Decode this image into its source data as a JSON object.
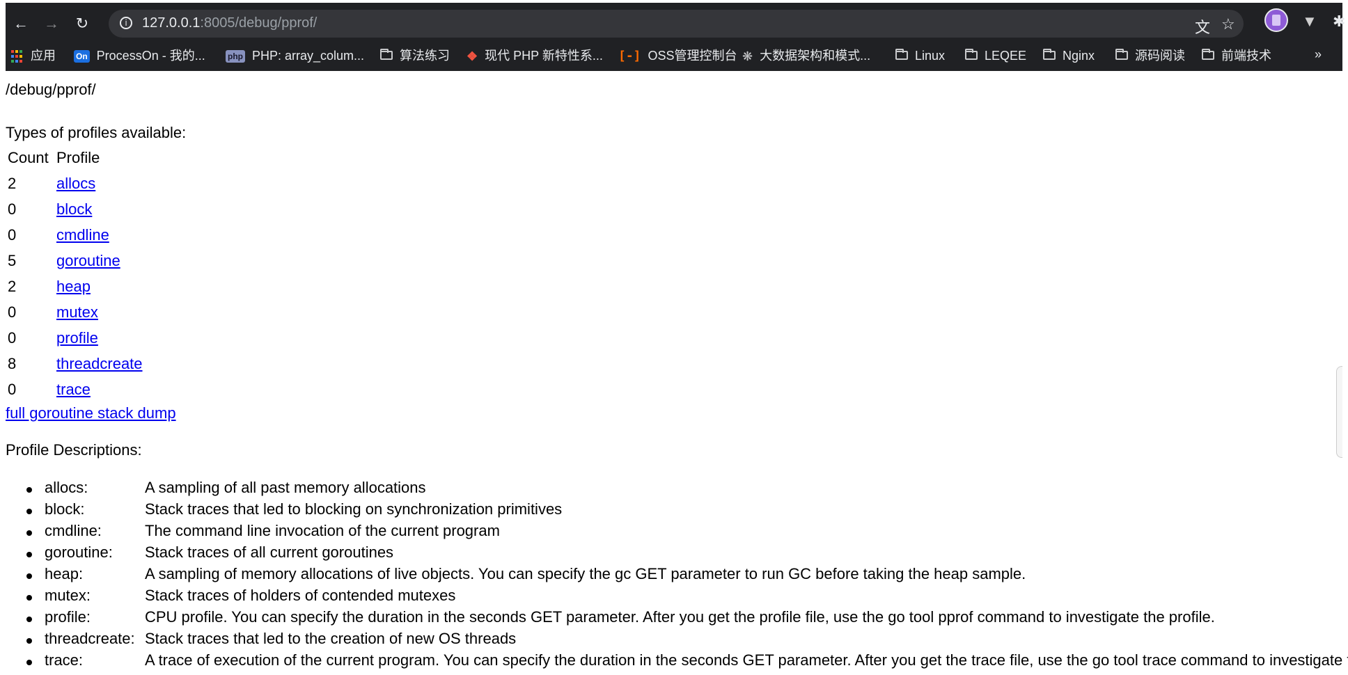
{
  "browser": {
    "url_host": "127.0.0.1",
    "url_rest": ":8005/debug/pprof/",
    "back_icon": "arrow-left-icon",
    "forward_icon": "arrow-right-icon",
    "reload_icon": "reload-icon",
    "bookmarks": [
      {
        "label": "应用",
        "icon": "apps-grid-icon"
      },
      {
        "label": "ProcessOn - 我的...",
        "icon": "processon-icon",
        "badge": "On"
      },
      {
        "label": "PHP: array_colum...",
        "icon": "php-icon",
        "badge": "php"
      },
      {
        "label": "算法练习",
        "icon": "folder-icon"
      },
      {
        "label": "现代 PHP 新特性系...",
        "icon": "laravel-icon"
      },
      {
        "label": "OSS管理控制台",
        "icon": "aliyun-icon"
      },
      {
        "label": "大数据架构和模式...",
        "icon": "bee-icon"
      },
      {
        "label": "Linux",
        "icon": "folder-icon"
      },
      {
        "label": "LEQEE",
        "icon": "folder-icon"
      },
      {
        "label": "Nginx",
        "icon": "folder-icon"
      },
      {
        "label": "源码阅读",
        "icon": "folder-icon"
      },
      {
        "label": "前端技术",
        "icon": "folder-icon"
      }
    ],
    "more_bookmarks": "»"
  },
  "page": {
    "path": "/debug/pprof/",
    "types_heading": "Types of profiles available:",
    "col_count": "Count",
    "col_profile": "Profile",
    "profiles": [
      {
        "count": "2",
        "name": "allocs"
      },
      {
        "count": "0",
        "name": "block"
      },
      {
        "count": "0",
        "name": "cmdline"
      },
      {
        "count": "5",
        "name": "goroutine"
      },
      {
        "count": "2",
        "name": "heap"
      },
      {
        "count": "0",
        "name": "mutex"
      },
      {
        "count": "0",
        "name": "profile"
      },
      {
        "count": "8",
        "name": "threadcreate"
      },
      {
        "count": "0",
        "name": "trace"
      }
    ],
    "full_dump_link": "full goroutine stack dump",
    "desc_heading": "Profile Descriptions:",
    "descriptions": [
      {
        "name": "allocs:",
        "text": "A sampling of all past memory allocations"
      },
      {
        "name": "block:",
        "text": "Stack traces that led to blocking on synchronization primitives"
      },
      {
        "name": "cmdline:",
        "text": "The command line invocation of the current program"
      },
      {
        "name": "goroutine:",
        "text": "Stack traces of all current goroutines"
      },
      {
        "name": "heap:",
        "text": "A sampling of memory allocations of live objects. You can specify the gc GET parameter to run GC before taking the heap sample."
      },
      {
        "name": "mutex:",
        "text": "Stack traces of holders of contended mutexes"
      },
      {
        "name": "profile:",
        "text": "CPU profile. You can specify the duration in the seconds GET parameter. After you get the profile file, use the go tool pprof command to investigate the profile."
      },
      {
        "name": "threadcreate:",
        "text": "Stack traces that led to the creation of new OS threads"
      },
      {
        "name": "trace:",
        "text": "A trace of execution of the current program. You can specify the duration in the seconds GET parameter. After you get the trace file, use the go tool trace command to investigate the trace."
      }
    ]
  }
}
